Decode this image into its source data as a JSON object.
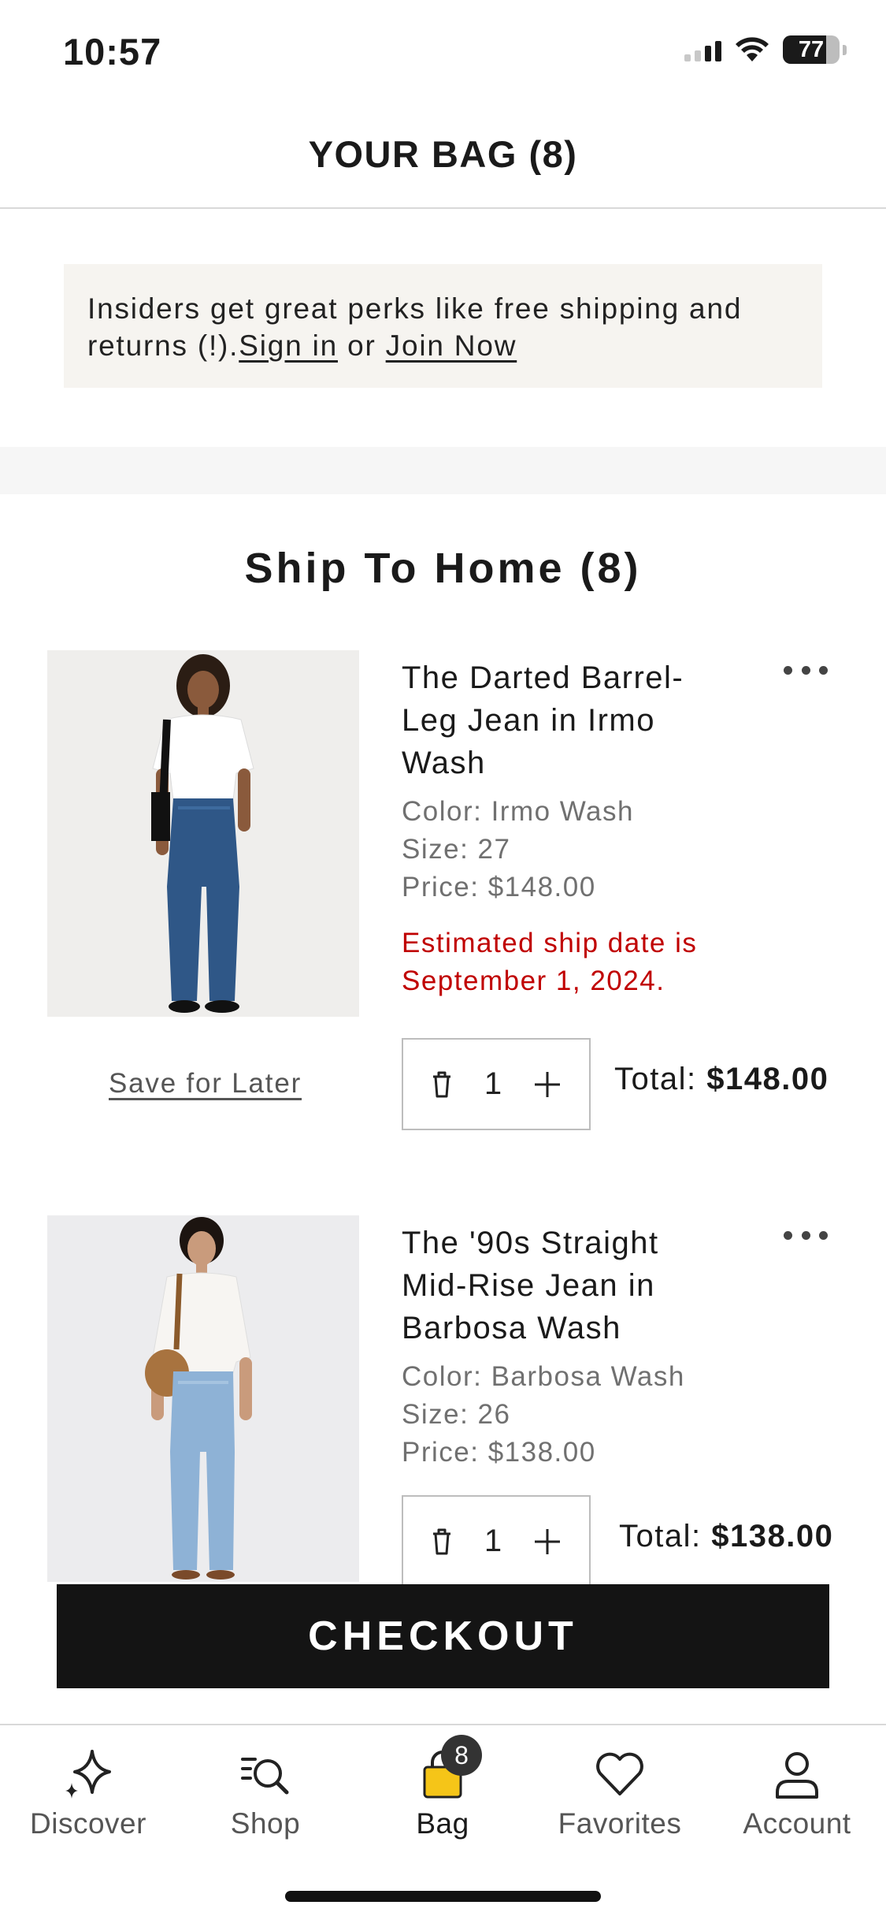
{
  "status_bar": {
    "time": "10:57",
    "battery": "77",
    "battery_level": 0.77
  },
  "header": {
    "title": "YOUR BAG (8)"
  },
  "banner": {
    "text": "Insiders get great perks like free shipping and returns (!).",
    "sign_in": "Sign in",
    "or": " or ",
    "join": "Join Now"
  },
  "section": {
    "title": "Ship To Home (8)"
  },
  "products": [
    {
      "name": "The Darted Barrel-Leg Jean in Irmo Wash",
      "color": "Color: Irmo Wash",
      "size": "Size: 27",
      "price": "Price: $148.00",
      "ship_date": "Estimated ship date is September 1, 2024.",
      "save_for_later": "Save for Later",
      "quantity": "1",
      "total_label": "Total: ",
      "total_value": "$148.00"
    },
    {
      "name": "The '90s Straight Mid-Rise Jean in Barbosa Wash",
      "color": "Color: Barbosa Wash",
      "size": "Size: 26",
      "price": "Price: $138.00",
      "quantity": "1",
      "total_label": "Total: ",
      "total_value": "$138.00"
    }
  ],
  "checkout": {
    "label": "CHECKOUT"
  },
  "tab_bar": {
    "items": [
      {
        "label": "Discover",
        "icon": "sparkle-icon"
      },
      {
        "label": "Shop",
        "icon": "search-list-icon"
      },
      {
        "label": "Bag",
        "icon": "bag-icon",
        "badge": "8"
      },
      {
        "label": "Favorites",
        "icon": "heart-icon"
      },
      {
        "label": "Account",
        "icon": "person-icon"
      }
    ]
  },
  "colors": {
    "accent": "#141414",
    "warning": "#c00000",
    "bag_icon": "#f5c518",
    "banner_bg": "#f6f4f0"
  }
}
